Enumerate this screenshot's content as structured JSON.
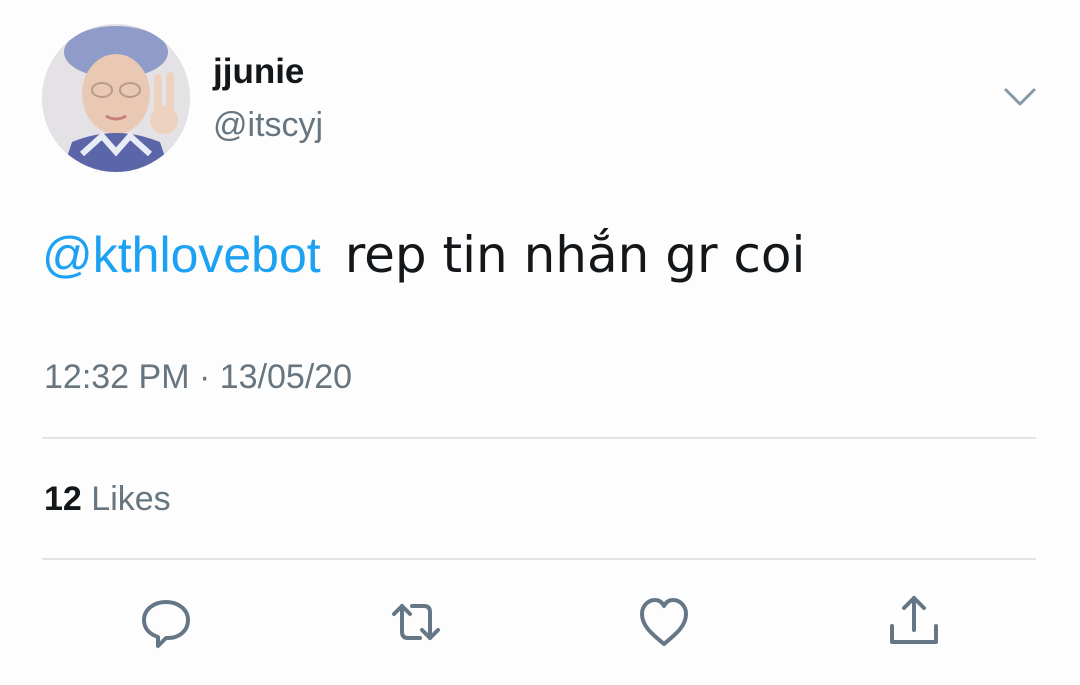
{
  "author": {
    "display_name": "jjunie",
    "handle": "@itscyj"
  },
  "tweet": {
    "mention": "@kthlovebot",
    "text": "rep tin nhắn gr coi",
    "timestamp": "12:32 PM · 13/05/20"
  },
  "stats": {
    "likes_count": "12",
    "likes_label": "Likes"
  },
  "icons": {
    "menu": "chevron-down-icon",
    "reply": "reply-icon",
    "retweet": "retweet-icon",
    "like": "heart-icon",
    "share": "share-icon"
  },
  "colors": {
    "link": "#1da1f2",
    "text": "#14171a",
    "secondary": "#66757f",
    "divider": "#e1e4e6"
  }
}
